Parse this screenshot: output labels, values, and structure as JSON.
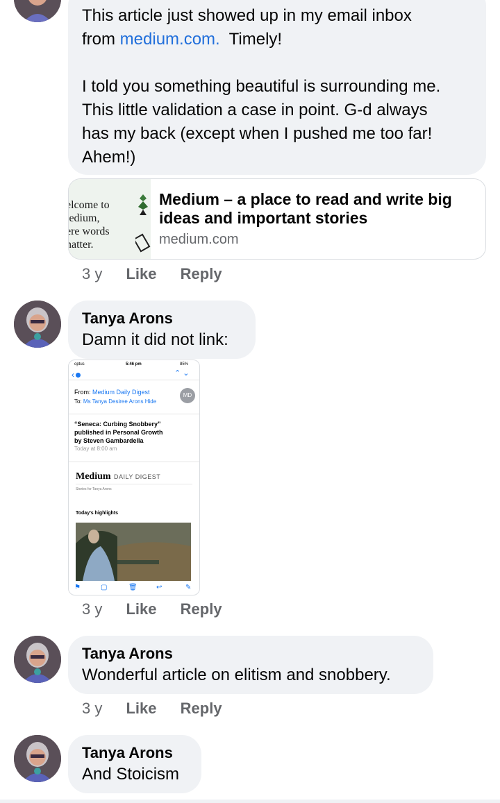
{
  "comment1": {
    "line1": "This article just showed up in my email inbox",
    "line2_prefix": "from ",
    "line2_link": "medium.com.",
    "line2_suffix": "  Timely!",
    "line3": "I told you something beautiful is surrounding me.",
    "line4": "This little validation a case in point.  G-d always",
    "line5": "has my back (except when I pushed me too far!",
    "line6": "Ahem!)",
    "preview": {
      "thumb_lines": [
        "elcome to",
        "ledium,",
        "ere words",
        "natter."
      ],
      "title_line1": "Medium – a place to read and write big",
      "title_line2": "ideas and important stories",
      "domain": "medium.com"
    },
    "meta": {
      "time": "3 y",
      "like": "Like",
      "reply": "Reply"
    }
  },
  "comment2": {
    "author": "Tanya Arons",
    "text": "Damn it did not link:",
    "screenshot": {
      "status_left": "optus",
      "status_time": "5:46 pm",
      "status_right": "85%",
      "from_label": "From:",
      "from_value": "Medium Daily Digest",
      "to_label": "To:",
      "to_value": "Ms Tanya Desiree Arons",
      "hide": "Hide",
      "avatar_initials": "MD",
      "subject1": "“Seneca: Curbing Snobbery”",
      "subject2": "published in Personal Growth",
      "subject3": "by Steven Gambardella",
      "date": "Today at 8:00 am",
      "brand": "Medium",
      "brand_sub": "DAILY DIGEST",
      "stories_for": "Stories for Tanya Arons",
      "highlights": "Today's highlights"
    },
    "meta": {
      "time": "3 y",
      "like": "Like",
      "reply": "Reply"
    }
  },
  "comment3": {
    "author": "Tanya Arons",
    "text": "Wonderful article on elitism and snobbery.",
    "meta": {
      "time": "3 y",
      "like": "Like",
      "reply": "Reply"
    }
  },
  "comment4": {
    "author": "Tanya Arons",
    "text": "And Stoicism"
  },
  "colors": {
    "bubble": "#f0f2f5",
    "link": "#216fdb",
    "meta": "#65676b"
  }
}
